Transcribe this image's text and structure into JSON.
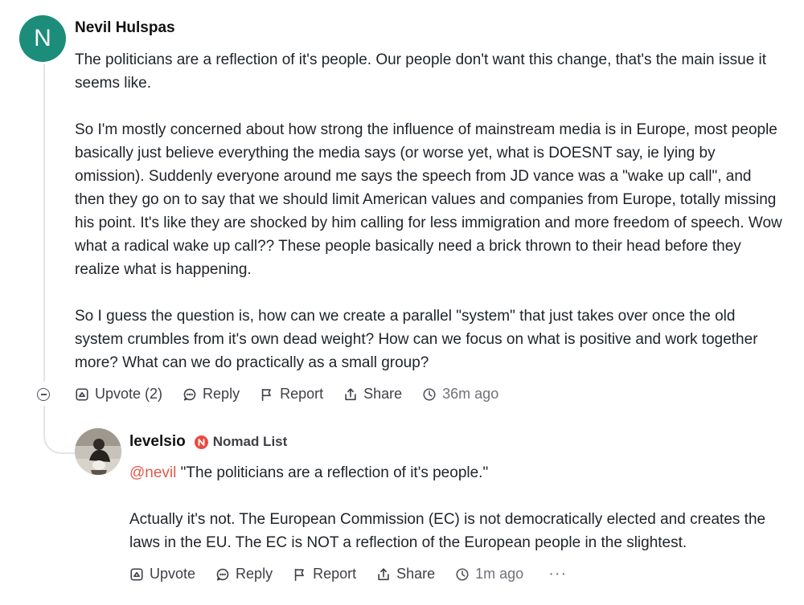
{
  "comment": {
    "avatar_initial": "N",
    "author": "Nevil Hulspas",
    "paragraphs": [
      "The politicians are a reflection of it's people. Our people don't want this change, that's the main issue it seems like.",
      "So I'm mostly concerned about how strong the influence of mainstream media is in Europe, most people basically just believe everything the media says (or worse yet, what is DOESNT say, ie lying by omission). Suddenly everyone around me says the speech from JD vance was a \"wake up call\", and then they go on to say that we should limit American values and companies from Europe, to­tally missing his point. It's like they are shocked by him calling for less immigration and more free­dom of speech. Wow what a radical wake up call?? These people basically need a brick thrown to their head before they realize what is happening.",
      "So I guess the question is, how can we create a parallel \"system\" that just takes over once the old system crumbles from it's own dead weight? How can we focus on what is positive and work to­gether more? What can we do practically as a small group?"
    ],
    "actions": {
      "upvote": "Upvote (2)",
      "reply": "Reply",
      "report": "Report",
      "share": "Share",
      "time": "36m ago"
    }
  },
  "reply": {
    "author": "levelsio",
    "badge": "Nomad List",
    "mention": "@nevil",
    "quote": " \"The politicians are a reflection of it's people.\"",
    "paragraph": "Actually it's not. The European Commission (EC) is not democratically elected and creates the laws in the EU. The EC is NOT a reflection of the European people in the slightest.",
    "actions": {
      "upvote": "Upvote",
      "reply": "Reply",
      "report": "Report",
      "share": "Share",
      "time": "1m ago",
      "more": "···"
    }
  },
  "colors": {
    "avatar_bg": "#1b8d7a",
    "badge": "#ea4b3f",
    "mention": "#e05a4b"
  },
  "icons": [
    "collapse-icon",
    "upvote-icon",
    "reply-icon",
    "report-flag-icon",
    "share-icon",
    "clock-icon",
    "more-icon",
    "nomad-list-badge-icon"
  ]
}
